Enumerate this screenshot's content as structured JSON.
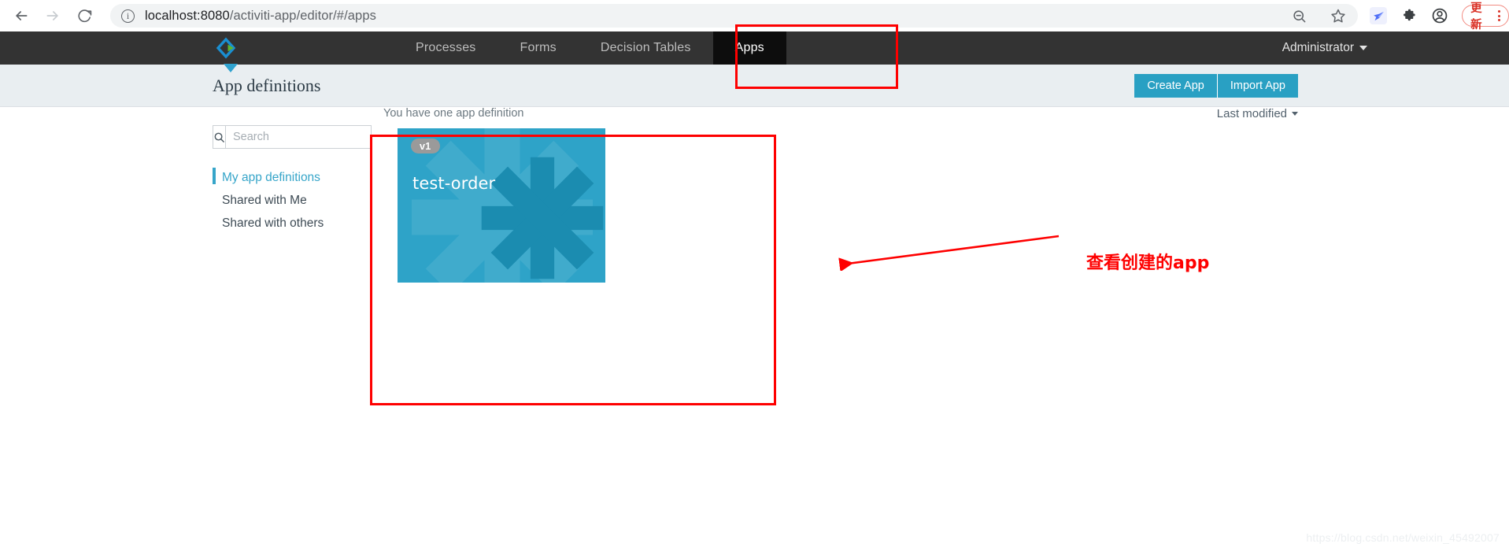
{
  "browser": {
    "back_label": "Back",
    "forward_label": "Forward",
    "reload_label": "Reload",
    "url_host": "localhost:8080",
    "url_path": "/activiti-app/editor/#/apps",
    "url_full": "localhost:8080/activiti-app/editor/#/apps",
    "site_info_label": "Site information",
    "zoom_out_label": "Zoom out",
    "bookmark_label": "Bookmark this tab",
    "extension_label": "Extension",
    "extensions_label": "Extensions",
    "profile_label": "Profile",
    "update_label": "更新",
    "menu_label": "Customize and control"
  },
  "navbar": {
    "logo_label": "Activiti",
    "tabs": [
      {
        "label": "Processes",
        "active": false
      },
      {
        "label": "Forms",
        "active": false
      },
      {
        "label": "Decision Tables",
        "active": false
      },
      {
        "label": "Apps",
        "active": true
      }
    ],
    "user": "Administrator"
  },
  "header": {
    "title": "App definitions",
    "create_label": "Create App",
    "import_label": "Import App"
  },
  "sidebar": {
    "search_placeholder": "Search",
    "search_value": "",
    "items": [
      {
        "label": "My app definitions",
        "active": true
      },
      {
        "label": "Shared with Me",
        "active": false
      },
      {
        "label": "Shared with others",
        "active": false
      }
    ]
  },
  "main": {
    "count_note": "You have one app definition",
    "sort_label": "Last modified",
    "cards": [
      {
        "version": "v1",
        "name": "test-order",
        "color": "#2ea3c8"
      }
    ]
  },
  "annotations": {
    "text": "查看创建的app",
    "color": "#fe0000",
    "box_apps_label": "highlight-apps-tab",
    "box_card_label": "highlight-app-card"
  },
  "watermark": "https://blog.csdn.net/weixin_45492007",
  "colors": {
    "accent": "#2ea3c8",
    "navbar": "#333333",
    "header_bg": "#e9eef1",
    "annotation": "#fe0000",
    "active_tab": "#0d0d0d"
  }
}
